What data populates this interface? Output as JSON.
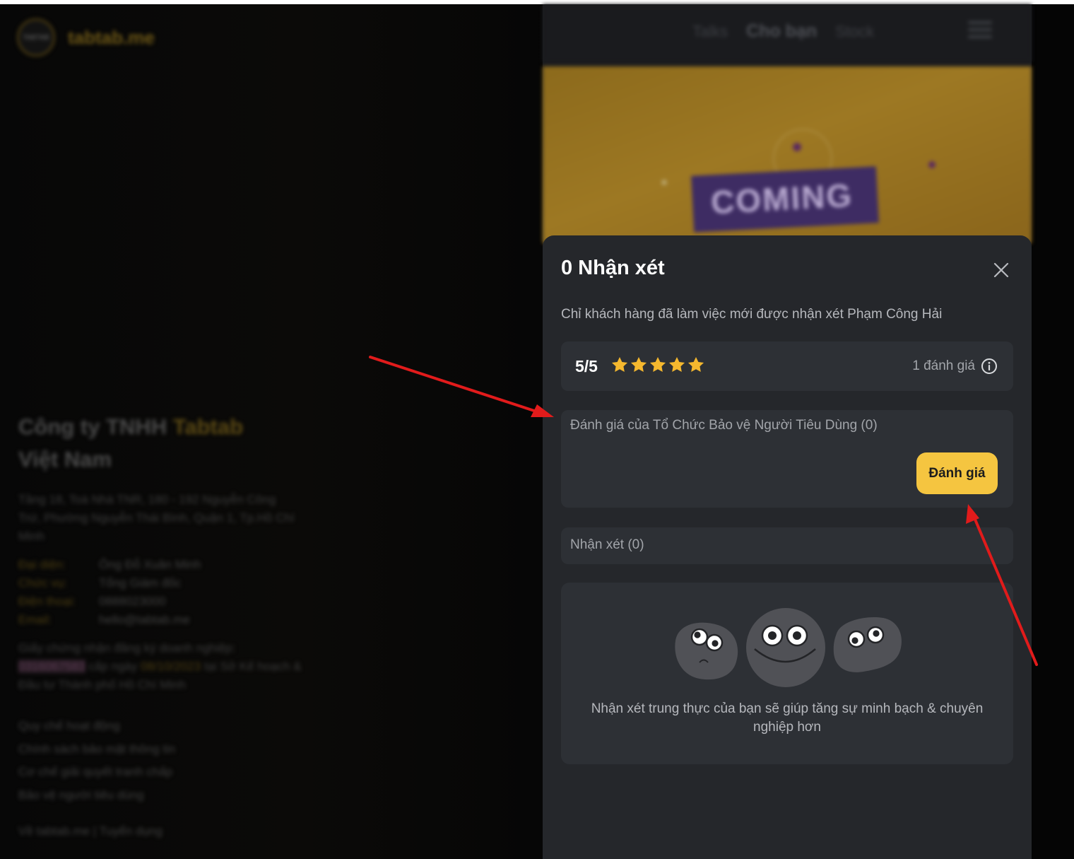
{
  "background": {
    "logo_mark": "TABTAB",
    "logo_text": "tabtab.me",
    "company_name_part1": "Công ty TNHH ",
    "company_name_highlight": "Tabtab",
    "company_name_part2": "Việt Nam",
    "address": "Tầng 18, Toà Nhà TNR, 180 - 192 Nguyễn Công Trứ, Phường Nguyễn Thái Bình, Quận 1, Tp.Hồ Chí Minh",
    "info": [
      {
        "key": "Đại diện:",
        "value": "Ông Đỗ Xuân Minh"
      },
      {
        "key": "Chức vụ:",
        "value": "Tổng Giám đốc"
      },
      {
        "key": "Điện thoại:",
        "value": "0888023000"
      },
      {
        "key": "Email:",
        "value": "hello@tabtab.me"
      }
    ],
    "cert_line1": "Giấy chứng nhận đăng ký doanh nghiệp:",
    "cert_number": "0316067583",
    "cert_mid": " cấp ngày ",
    "cert_date": "08/10/2023",
    "cert_tail": " tại Sở Kế hoạch & Đầu tư Thành phố Hồ Chí Minh",
    "links": [
      "Quy chế hoạt động",
      "Chính sách bảo mật thông tin",
      "Cơ chế giải quyết tranh chấp",
      "Bảo vệ người tiêu dùng"
    ],
    "footer_links": "Về tabtab.me | Tuyển dụng",
    "nav_tabs": [
      "Talks",
      "Cho bạn",
      "Stock"
    ],
    "banner_text": "COMING"
  },
  "modal": {
    "title": "0 Nhận xét",
    "subtitle": "Chỉ khách hàng đã làm việc mới được nhận xét Phạm Công Hải",
    "score": "5/5",
    "star_count": 5,
    "rating_count": "1 đánh giá",
    "org_review_label": "Đánh giá của Tổ Chức Bảo vệ Người Tiêu Dùng (0)",
    "rate_button": "Đánh giá",
    "reviews_label": "Nhận xét (0)",
    "empty_message": "Nhận xét trung thực của bạn sẽ giúp tăng sự minh bạch & chuyên nghiệp hơn"
  },
  "colors": {
    "accent": "#f5c540",
    "star": "#f5b82e",
    "annotation_arrow": "#e11b1b",
    "modal_bg": "#25272b",
    "card_bg": "#2d3035"
  }
}
